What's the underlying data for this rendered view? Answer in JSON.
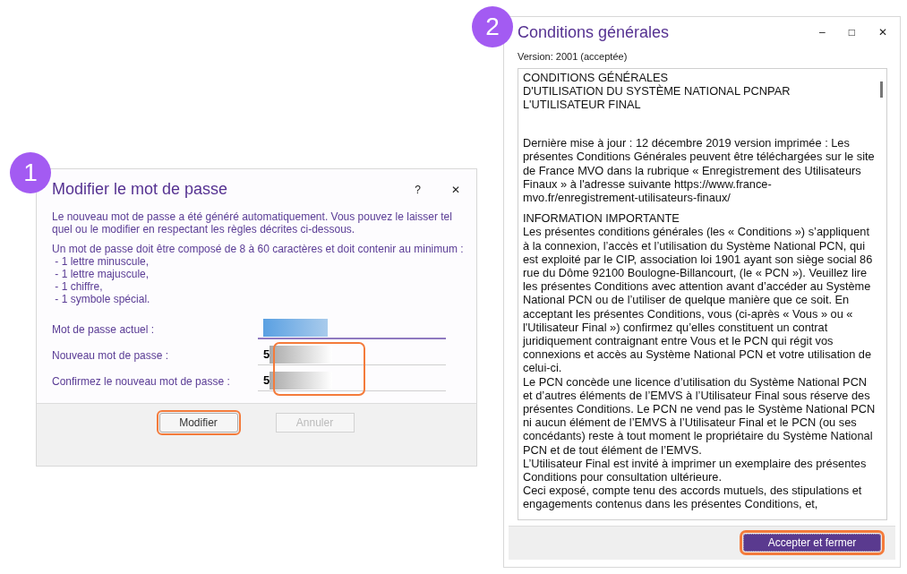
{
  "badges": [
    "1",
    "2"
  ],
  "password_dialog": {
    "title": "Modifier le mot de passe",
    "help": "?",
    "close": "✕",
    "intro": "Le nouveau mot de passe a été généré automatiquement. Vous pouvez le laisser tel quel ou le modifier en respectant les règles décrites ci-dessous.",
    "rules": [
      "Un mot de passe doit être composé de 8 à 60 caractères et doit contenir au minimum :",
      " - 1 lettre minuscule,",
      " - 1 lettre majuscule,",
      " - 1 chiffre,",
      " - 1 symbole spécial."
    ],
    "fields": [
      {
        "label": "Mot de passe actuel :",
        "kind": "selected-mask",
        "highlighted": false
      },
      {
        "label": "Nouveau mot de passe :",
        "value": "5",
        "kind": "blurred",
        "highlighted": true
      },
      {
        "label": "Confirmez le nouveau mot de passe :",
        "value": "5",
        "kind": "blurred",
        "highlighted": true
      }
    ],
    "buttons": [
      {
        "label": "Modifier",
        "disabled": false,
        "highlighted": true
      },
      {
        "label": "Annuler",
        "disabled": true,
        "highlighted": false
      }
    ]
  },
  "terms_window": {
    "title": "Conditions générales",
    "minimize": "–",
    "maximize": "□",
    "close": "✕",
    "version": "Version: 2001 (acceptée)",
    "heading_lines": [
      "CONDITIONS GÉNÉRALES",
      "D'UTILISATION DU SYSTÈME NATIONAL PCNPAR",
      "L'UTILISATEUR FINAL"
    ],
    "paragraphs": [
      {
        "kind": "spaced",
        "text": "Dernière mise à jour : 12 décembre 2019 version imprimée : Les présentes Conditions Générales peuvent être téléchargées sur le site de France MVO dans la rubrique « Enregistrement des Utilisateurs Finaux » à l'adresse suivante  https://www.france-mvo.fr/enregistrement-utilisateurs-finaux/"
      },
      {
        "kind": "spaced",
        "text": "INFORMATION IMPORTANTE"
      },
      {
        "kind": "plain",
        "text": "Les présentes conditions générales (les « Conditions ») s’appliquent à la connexion, l’accès et l’utilisation du Système National PCN, qui est exploité par le CIP, association loi 1901 ayant son siège social 86 rue du Dôme 92100 Boulogne-Billancourt, (le « PCN »). Veuillez lire les présentes Conditions avec attention avant d’accéder au Système National PCN ou de l’utiliser de quelque manière que ce soit. En acceptant les présentes Conditions, vous (ci-après « Vous » ou « l'Utilisateur Final ») confirmez qu’elles constituent un contrat juridiquement contraignant entre Vous et le PCN qui régit vos connexions et accès au Système National PCN et votre utilisation de celui-ci."
      },
      {
        "kind": "plain",
        "text": "Le PCN concède une licence d’utilisation du Système National PCN et d’autres éléments de l’EMVS à l’Utilisateur Final sous réserve des présentes Conditions. Le PCN ne vend pas le Système National PCN ni aucun élément de l’EMVS à l’Utilisateur Final et le PCN (ou ses concédants) reste à tout moment le propriétaire du Système National PCN et de tout élément de l’EMVS."
      },
      {
        "kind": "plain",
        "text": "L’Utilisateur Final est invité à imprimer un exemplaire des présentes Conditions pour consultation ultérieure."
      },
      {
        "kind": "plain",
        "text": "Ceci exposé, compte tenu des accords mutuels, des stipulations et engagements contenus dans les présentes Conditions, et,"
      }
    ],
    "accept_button": {
      "label": "Accepter et fermer",
      "highlighted": true
    }
  }
}
